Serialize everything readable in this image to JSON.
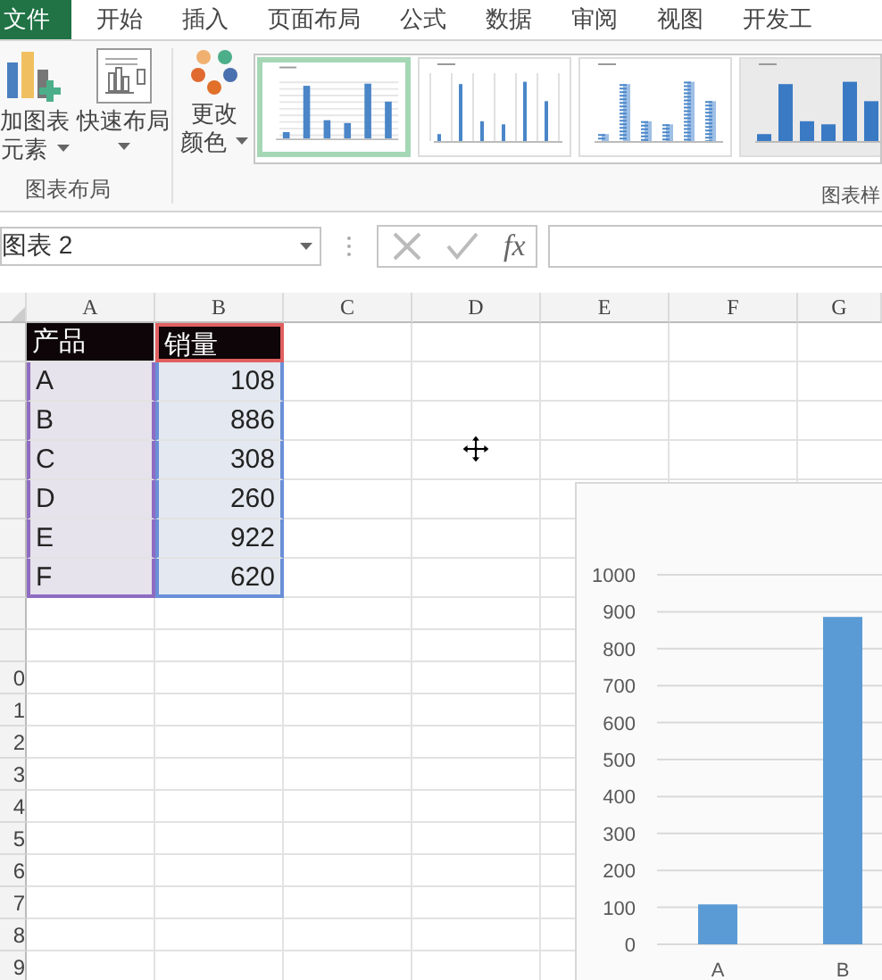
{
  "ribbon_tabs": [
    {
      "label": "文件",
      "kind": "file",
      "selected": false
    },
    {
      "label": "开始",
      "kind": "tab",
      "selected": false
    },
    {
      "label": "插入",
      "kind": "tab",
      "selected": false
    },
    {
      "label": "页面布局",
      "kind": "tab",
      "selected": false
    },
    {
      "label": "公式",
      "kind": "tab",
      "selected": false
    },
    {
      "label": "数据",
      "kind": "tab",
      "selected": false
    },
    {
      "label": "审阅",
      "kind": "tab",
      "selected": false
    },
    {
      "label": "视图",
      "kind": "tab",
      "selected": false
    },
    {
      "label": "开发工",
      "kind": "tab",
      "selected": false
    }
  ],
  "ribbon_group_layout": {
    "label": "图表布局",
    "buttons": [
      {
        "kind": "add_element",
        "lines": [
          "加图表",
          "元素"
        ]
      },
      {
        "kind": "quick_layout",
        "lines": [
          "快速布局"
        ]
      }
    ]
  },
  "ribbon_group_styles": {
    "label": "图表样",
    "color_button": {
      "kind": "change_colors",
      "lines": [
        "更改",
        "颜色"
      ]
    },
    "chart_styles": [
      {
        "kind": "gridlines",
        "selected": true
      },
      {
        "kind": "vertical_lines",
        "selected": false
      },
      {
        "kind": "striped",
        "selected": false
      },
      {
        "kind": "shaded",
        "selected": false
      }
    ]
  },
  "formula_bar": {
    "name_box": "图表 2",
    "function_button": "fx"
  },
  "columns": [
    "A",
    "B",
    "C",
    "D",
    "E",
    "F",
    "G"
  ],
  "row_numbers": [
    "0",
    "1",
    "2",
    "3",
    "4",
    "5",
    "6",
    "7",
    "8",
    "9"
  ],
  "table": {
    "header": [
      "产品",
      "销量"
    ],
    "rows": [
      [
        "A",
        "108"
      ],
      [
        "B",
        "886"
      ],
      [
        "C",
        "308"
      ],
      [
        "D",
        "260"
      ],
      [
        "E",
        "922"
      ],
      [
        "F",
        "620"
      ]
    ]
  },
  "chart": {
    "chart_data": {
      "type": "bar",
      "grid": true,
      "categories": [
        "A",
        "B"
      ],
      "values": [
        108,
        886
      ],
      "ylim": [
        0,
        1000
      ],
      "yticks": [
        0,
        100,
        200,
        300,
        400,
        500,
        600,
        700,
        800,
        900,
        1000
      ]
    }
  }
}
